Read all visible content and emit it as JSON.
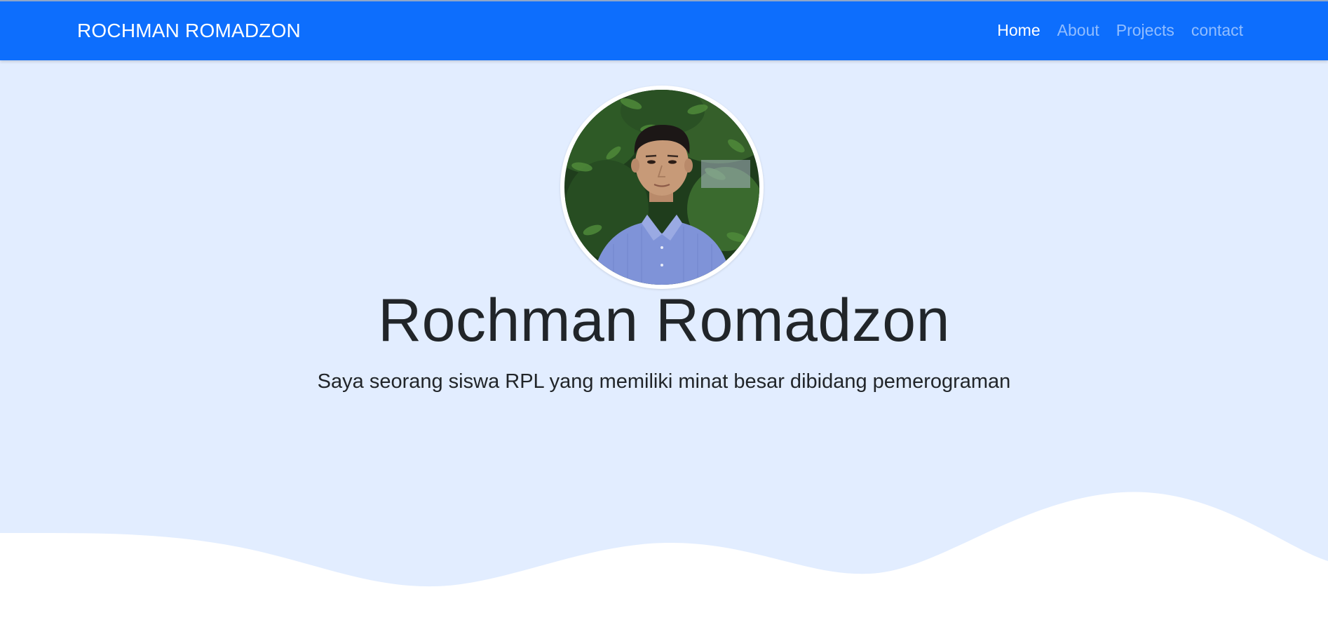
{
  "navbar": {
    "brand": "ROCHMAN ROMADZON",
    "links": [
      {
        "label": "Home",
        "active": true
      },
      {
        "label": "About",
        "active": false
      },
      {
        "label": "Projects",
        "active": false
      },
      {
        "label": "contact",
        "active": false
      }
    ]
  },
  "hero": {
    "title": "Rochman Romadzon",
    "subtitle": "Saya seorang siswa RPL yang memiliki minat besar dibidang pemerograman",
    "avatar_icon": "profile-photo"
  },
  "colors": {
    "navbar_bg": "#0d6efd",
    "hero_bg": "#e2edff",
    "wave_fill": "#ffffff",
    "text": "#212529"
  }
}
